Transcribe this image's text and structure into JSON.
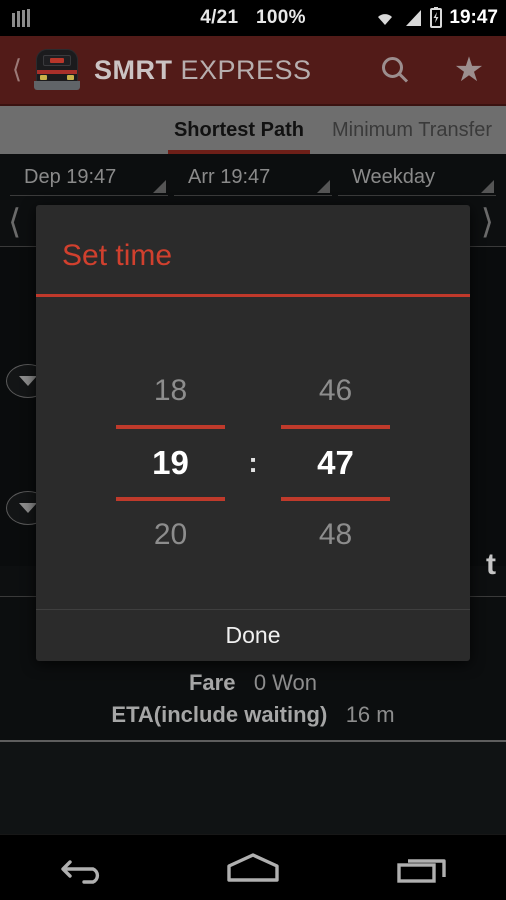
{
  "status_bar": {
    "sim_icon": "signal-bars-icon",
    "date": "4/21",
    "battery_percent": "100%",
    "wifi_icon": "wifi-icon",
    "signal_icon": "cell-signal-icon",
    "battery_icon": "battery-charging-icon",
    "clock": "19:47"
  },
  "action_bar": {
    "back_icon": "back-chevron-icon",
    "app_icon": "train-icon",
    "title_bold": "SMRT",
    "title_light": " EXPRESS",
    "search_icon": "search-icon",
    "favorite_icon": "star-icon",
    "background_color": "#521b18"
  },
  "tabs": [
    {
      "label": "Shortest Path",
      "active": true
    },
    {
      "label": "Minimum Transfer",
      "active": false
    }
  ],
  "filters": [
    {
      "label": "Dep 19:47",
      "icon": "dropdown-triangle-icon"
    },
    {
      "label": "Arr 19:47",
      "icon": "dropdown-triangle-icon"
    },
    {
      "label": "Weekday",
      "icon": "dropdown-triangle-icon"
    }
  ],
  "pager": {
    "prev_icon": "prev-chevron-icon",
    "next_icon": "next-chevron-icon"
  },
  "route_detail": {
    "expand_icon": "expand-triangle-icon",
    "partial_text": "t",
    "fare_label": "Fare",
    "fare_value": "0 Won",
    "eta_label": "ETA(include waiting)",
    "eta_value": "16 m"
  },
  "dialog": {
    "title": "Set time",
    "accent_color": "#c0392b",
    "background_color": "#2b2b2b",
    "hour": {
      "previous": "18",
      "selected": "19",
      "next": "20"
    },
    "separator": ":",
    "minute": {
      "previous": "46",
      "selected": "47",
      "next": "48"
    },
    "done_label": "Done"
  },
  "nav_bar": {
    "back_icon": "nav-back-icon",
    "home_icon": "nav-home-icon",
    "recents_icon": "nav-recents-icon"
  }
}
